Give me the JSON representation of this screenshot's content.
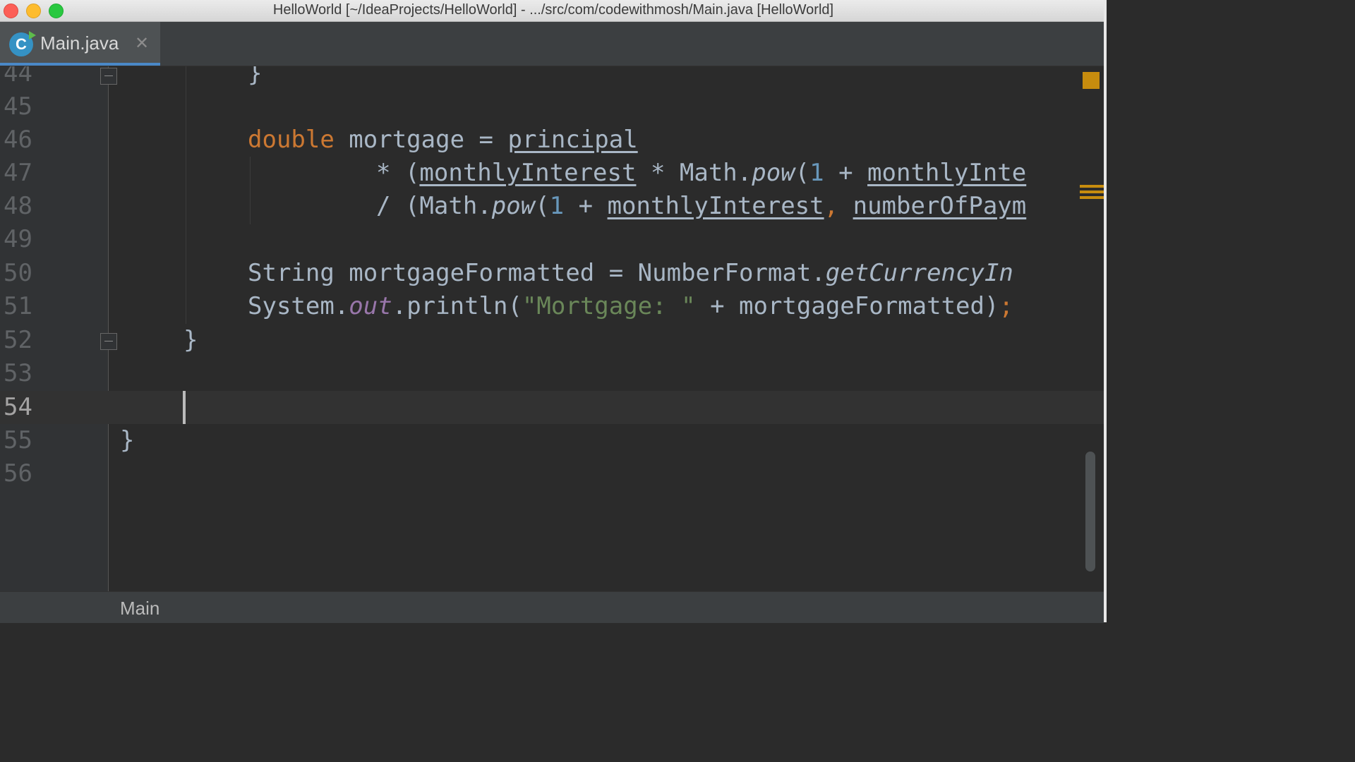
{
  "window": {
    "title": "HelloWorld [~/IdeaProjects/HelloWorld] - .../src/com/codewithmosh/Main.java [HelloWorld]"
  },
  "tabs": [
    {
      "label": "Main.java",
      "icon": "java-class-icon",
      "icon_letter": "C",
      "active": true
    }
  ],
  "editor": {
    "current_line": 54,
    "lines": [
      {
        "num": "44"
      },
      {
        "num": "45"
      },
      {
        "num": "46"
      },
      {
        "num": "47"
      },
      {
        "num": "48"
      },
      {
        "num": "49"
      },
      {
        "num": "50"
      },
      {
        "num": "51"
      },
      {
        "num": "52"
      },
      {
        "num": "53"
      },
      {
        "num": "54"
      },
      {
        "num": "55"
      },
      {
        "num": "56"
      }
    ],
    "tokens": {
      "l44_brace": "}",
      "l46_double": "double",
      "l46_mid": " mortgage = ",
      "l46_principal": "principal",
      "l47_op": "* (",
      "l47_monthly": "monthlyInterest",
      "l47_mid": " * Math.",
      "l47_pow": "pow",
      "l47_paren": "(",
      "l47_one": "1",
      "l47_plus": " + ",
      "l47_monthly2": "monthlyInte",
      "l48_op": "/ (Math.",
      "l48_pow": "pow",
      "l48_paren": "(",
      "l48_one": "1",
      "l48_plus": " + ",
      "l48_monthly": "monthlyInterest",
      "l48_comma": ",",
      "l48_space": " ",
      "l48_number": "numberOfPaym",
      "l50_start": "String mortgageFormatted = NumberFormat.",
      "l50_method": "getCurrencyIn",
      "l51_start": "System.",
      "l51_out": "out",
      "l51_mid": ".println(",
      "l51_str": "\"Mortgage: \"",
      "l51_end": " + mortgageFormatted)",
      "l51_semi": ";",
      "l52_brace": "}",
      "l55_brace": "}"
    }
  },
  "breadcrumb": {
    "label": "Main"
  },
  "colors": {
    "keyword": "#cc7832",
    "number": "#6897bb",
    "string": "#6a8759",
    "field": "#9876aa",
    "identifier": "#a9b7c6",
    "warning": "#c78c0e",
    "tab_accent": "#4a88c7"
  }
}
